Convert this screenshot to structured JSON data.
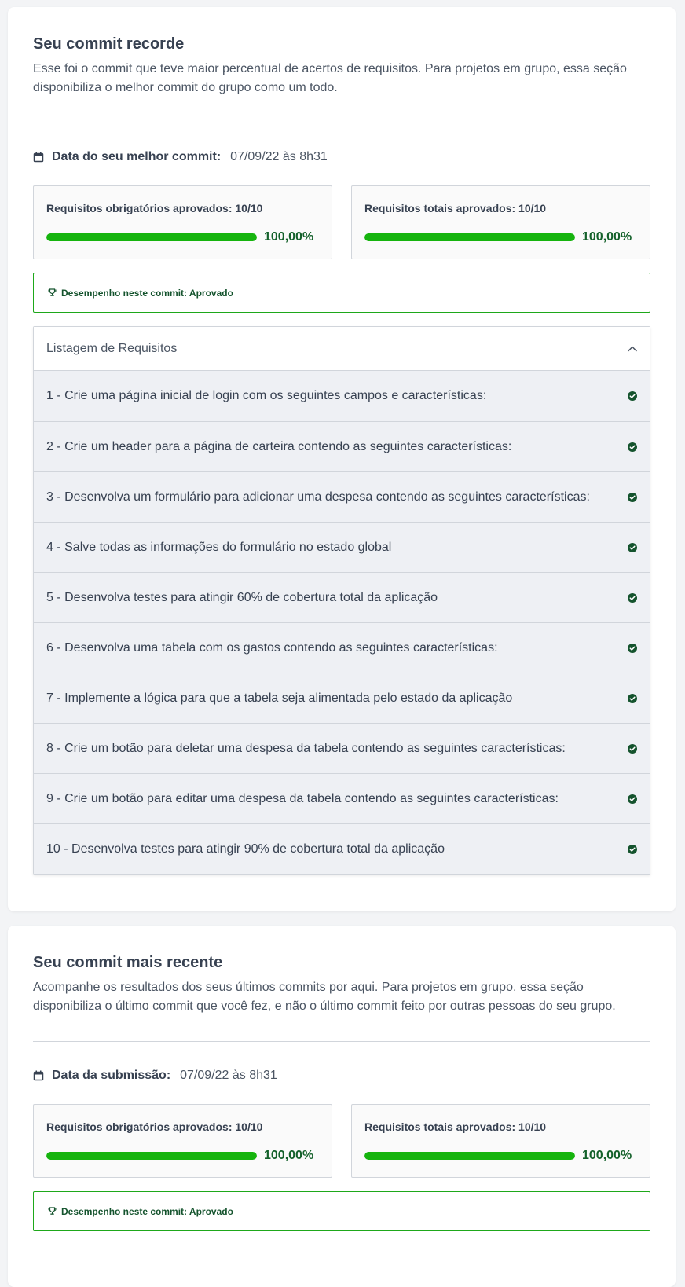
{
  "best": {
    "title": "Seu commit recorde",
    "description": "Esse foi o commit que teve maior percentual de acertos de requisitos. Para projetos em grupo, essa seção disponibiliza o melhor commit do grupo como um todo.",
    "date_label": "Data do seu melhor commit:",
    "date_value": "07/09/22 às 8h31",
    "mandatory_label": "Requisitos obrigatórios aprovados: 10/10",
    "mandatory_progress": 1.0,
    "mandatory_pct": "100,00%",
    "total_label": "Requisitos totais aprovados: 10/10",
    "total_progress": 1.0,
    "total_pct": "100,00%",
    "performance": "Desempenho neste commit: Aprovado",
    "list_title": "Listagem de Requisitos",
    "list_icon": "chevron-up-icon",
    "requirements": [
      "1 - Crie uma página inicial de login com os seguintes campos e características:",
      "2 - Crie um header para a página de carteira contendo as seguintes características:",
      "3 - Desenvolva um formulário para adicionar uma despesa contendo as seguintes características:",
      "4 - Salve todas as informações do formulário no estado global",
      "5 - Desenvolva testes para atingir 60% de cobertura total da aplicação",
      "6 - Desenvolva uma tabela com os gastos contendo as seguintes características:",
      "7 - Implemente a lógica para que a tabela seja alimentada pelo estado da aplicação",
      "8 - Crie um botão para deletar uma despesa da tabela contendo as seguintes características:",
      "9 - Crie um botão para editar uma despesa da tabela contendo as seguintes características:",
      "10 - Desenvolva testes para atingir 90% de cobertura total da aplicação"
    ]
  },
  "recent": {
    "title": "Seu commit mais recente",
    "description": "Acompanhe os resultados dos seus últimos commits por aqui. Para projetos em grupo, essa seção disponibiliza o último commit que você fez, e não o último commit feito por outras pessoas do seu grupo.",
    "date_label": "Data da submissão:",
    "date_value": "07/09/22 às 8h31",
    "mandatory_label": "Requisitos obrigatórios aprovados: 10/10",
    "mandatory_progress": 1.0,
    "mandatory_pct": "100,00%",
    "total_label": "Requisitos totais aprovados: 10/10",
    "total_progress": 1.0,
    "total_pct": "100,00%",
    "performance": "Desempenho neste commit: Aprovado"
  },
  "colors": {
    "accent_green": "#16b40e",
    "check_green": "#14532d",
    "text": "#374151"
  },
  "icons": {
    "date": "calendar-icon",
    "performance": "trophy-icon",
    "requirement_status": "check-circle-icon"
  }
}
